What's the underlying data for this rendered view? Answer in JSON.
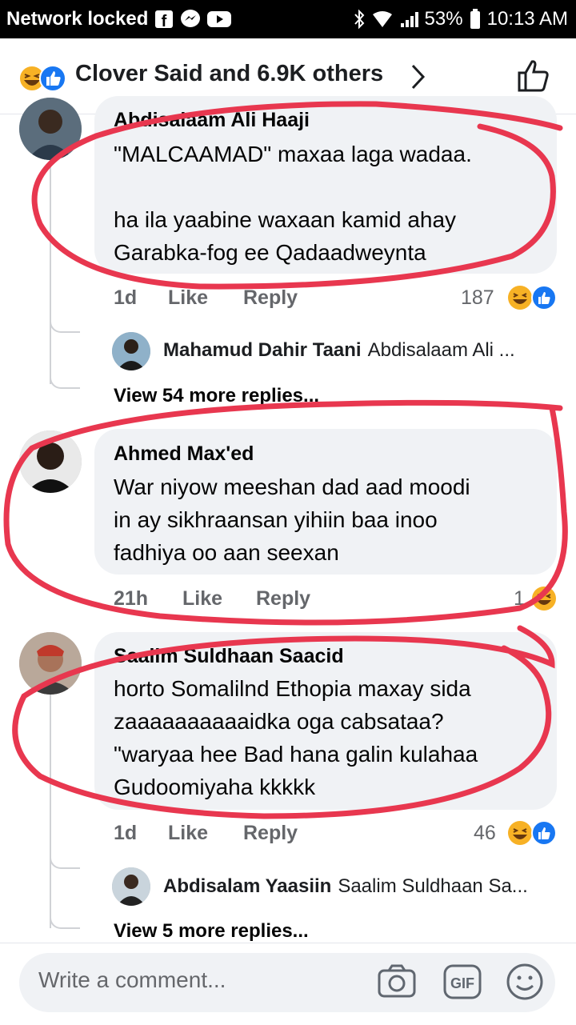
{
  "status_bar": {
    "carrier": "Network locked",
    "battery": "53%",
    "time": "10:13 AM"
  },
  "header": {
    "title": "Clover Said and 6.9K others"
  },
  "comments": [
    {
      "author": "Abdisalaam Ali Haaji",
      "text": "\"MALCAAMAD\" maxaa laga wadaa.\n\nha ila yaabine waxaan kamid ahay\nGarabka-fog ee Qadaadweynta",
      "time": "1d",
      "like": "Like",
      "reply": "Reply",
      "reaction_count": "187",
      "reply_preview": {
        "name": "Mahamud Dahir Taani",
        "text": "Abdisalaam Ali ..."
      },
      "more_replies": "View 54 more replies..."
    },
    {
      "author": "Ahmed Max'ed",
      "text": "War niyow meeshan dad aad moodi\nin ay sikhraansan yihiin baa inoo\nfadhiya oo aan seexan",
      "time": "21h",
      "like": "Like",
      "reply": "Reply",
      "reaction_count": "1"
    },
    {
      "author": "Saalim Suldhaan Saacid",
      "text": "horto Somalilnd Ethopia maxay sida\nzaaaaaaaaaaidka oga cabsataa?\n\"waryaa hee Bad hana galin kulahaa\nGudoomiyaha kkkkk",
      "time": "1d",
      "like": "Like",
      "reply": "Reply",
      "reaction_count": "46",
      "reply_preview": {
        "name": "Abdisalam Yaasiin",
        "text": "Saalim Suldhaan Sa..."
      },
      "more_replies": "View 5 more replies..."
    }
  ],
  "composer": {
    "placeholder": "Write a comment..."
  },
  "colors": {
    "like_blue": "#1877f2",
    "haha_yellow": "#f7b125",
    "annotation_red": "#e8374f"
  }
}
